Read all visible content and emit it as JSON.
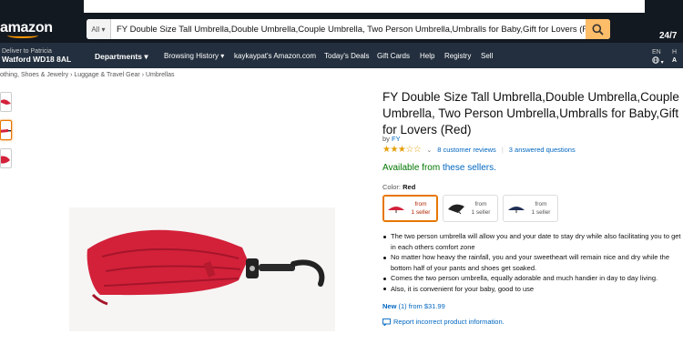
{
  "header": {
    "logo_text": "amazon",
    "search": {
      "category": "All",
      "query": "FY Double Size Tall Umbrella,Double Umbrella,Couple Umbrella, Two Person Umbrella,Umbralls for Baby,Gift for Lovers (Red)"
    },
    "promo_text": "24/7"
  },
  "nav": {
    "deliver_line1": "Deliver to Patricia",
    "deliver_line2": "Watford WD18 8AL",
    "items": [
      {
        "label": "Departments ▾"
      },
      {
        "label": "Browsing History ▾"
      },
      {
        "label": "kaykaypat's Amazon.com"
      },
      {
        "label": "Today's Deals"
      },
      {
        "label": "Gift Cards"
      },
      {
        "label": "Help"
      },
      {
        "label": "Registry"
      },
      {
        "label": "Sell"
      }
    ],
    "lang_code": "EN",
    "lang_icon": "globe-icon",
    "hello_line1": "H",
    "hello_line2": "A"
  },
  "breadcrumb": [
    "othing, Shoes & Jewelry",
    "Luggage & Travel Gear",
    "Umbrellas"
  ],
  "product": {
    "title": "FY Double Size Tall Umbrella,Double Umbrella,Couple Umbrella, Two Person Umbrella,Umbralls for Baby,Gift for Lovers (Red)",
    "by_prefix": "by",
    "brand": "FY",
    "rating_stars": 3,
    "rating_display": "★★★☆☆",
    "reviews": "8 customer reviews",
    "questions": "3 answered questions",
    "availability_prefix": "Available from",
    "availability_link": "these sellers.",
    "color_label": "Color:",
    "color_value": "Red",
    "swatches": [
      {
        "line1": "from",
        "line2": "1 seller",
        "color": "#d3213a"
      },
      {
        "line1": "from",
        "line2": "1 seller",
        "color": "#222222"
      },
      {
        "line1": "from",
        "line2": "1 seller",
        "color": "#1f2f55"
      }
    ],
    "bullets": [
      "The two person umbrella will allow you and your date to stay dry while also facilitating you to get in each others comfort zone",
      "No matter how heavy the rainfall, you and your sweetheart will remain nice and dry while the bottom half of your pants and shoes get soaked.",
      "Comes the two person umbrella, equally adorable and much handier in day to day living.",
      "Also, it is convenient for your baby, good to use"
    ],
    "new_label": "New",
    "new_rest": " (1) from $31.99",
    "report": "Report incorrect product information."
  },
  "colors": {
    "header_bg": "#131921",
    "nav_bg": "#232f3e",
    "search_button": "#febd69",
    "link": "#0066c0",
    "in_stock": "#007600",
    "umbrella_red": "#d3213a"
  }
}
